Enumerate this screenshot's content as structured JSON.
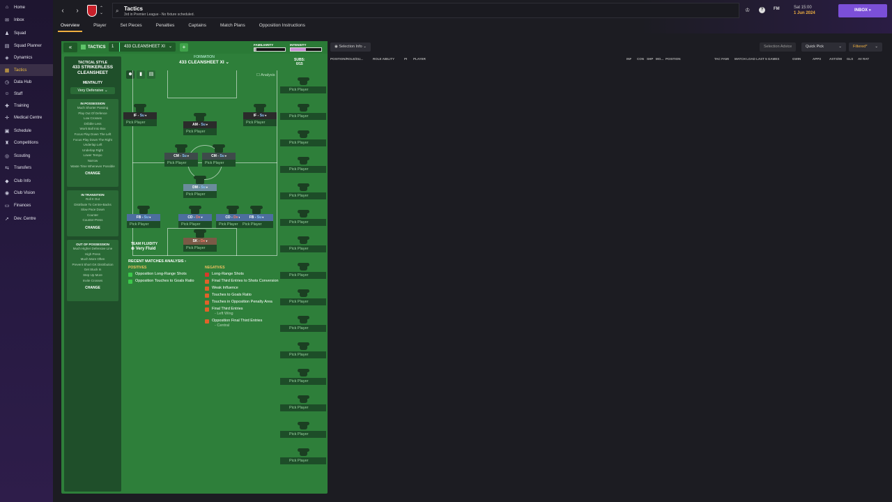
{
  "sidebar": {
    "items": [
      {
        "label": "Home",
        "icon": "home-icon",
        "glyph": "⌂"
      },
      {
        "label": "Inbox",
        "icon": "inbox-icon",
        "glyph": "✉"
      },
      {
        "label": "Squad",
        "icon": "squad-icon",
        "glyph": "♟"
      },
      {
        "label": "Squad Planner",
        "icon": "planner-icon",
        "glyph": "▤"
      },
      {
        "label": "Dynamics",
        "icon": "dynamics-icon",
        "glyph": "◈"
      },
      {
        "label": "Tactics",
        "icon": "tactics-icon",
        "glyph": "▦"
      },
      {
        "label": "Data Hub",
        "icon": "data-hub-icon",
        "glyph": "◷"
      },
      {
        "label": "Staff",
        "icon": "staff-icon",
        "glyph": "☺"
      },
      {
        "label": "Training",
        "icon": "training-icon",
        "glyph": "✚"
      },
      {
        "label": "Medical Centre",
        "icon": "medical-icon",
        "glyph": "✛"
      },
      {
        "label": "Schedule",
        "icon": "schedule-icon",
        "glyph": "▣"
      },
      {
        "label": "Competitions",
        "icon": "competitions-icon",
        "glyph": "♜"
      },
      {
        "label": "Scouting",
        "icon": "scouting-icon",
        "glyph": "◎"
      },
      {
        "label": "Transfers",
        "icon": "transfers-icon",
        "glyph": "⇆"
      },
      {
        "label": "Club Info",
        "icon": "club-info-icon",
        "glyph": "◆"
      },
      {
        "label": "Club Vision",
        "icon": "club-vision-icon",
        "glyph": "◉"
      },
      {
        "label": "Finances",
        "icon": "finances-icon",
        "glyph": "▭"
      },
      {
        "label": "Dev. Centre",
        "icon": "dev-centre-icon",
        "glyph": "➚"
      }
    ],
    "active": "Tactics"
  },
  "header": {
    "title": "Tactics",
    "subtitle": "3rd in Premier League - No fixture scheduled.",
    "time": "Sat 15:00",
    "date": "1 Jun 2024",
    "fm_label": "FM",
    "inbox_label": "INBOX"
  },
  "tabs": [
    "Overview",
    "Player",
    "Set Pieces",
    "Penalties",
    "Captains",
    "Match Plans",
    "Opposition Instructions"
  ],
  "tactics_bar": {
    "label": "TACTICS",
    "number": "1",
    "name": "433 CLEANSHEET XI",
    "familiarity_label": "FAMILIARITY",
    "intensity_label": "INTENSITY",
    "familiarity": 0.0,
    "intensity": 0.5
  },
  "left_col": {
    "style_label": "TACTICAL STYLE",
    "style_name": "433 STRIKERLESS CLEANSHEET",
    "mentality_label": "MENTALITY",
    "mentality": "Very Defensive",
    "in_possession": {
      "title": "IN POSSESSION",
      "lines": [
        "Much Shorter Passing",
        "Play Out Of Defence",
        "Low Crosses",
        "Dribble Less",
        "Work Ball Into Box",
        "Focus Play Down The Left",
        "Focus Play Down The Right",
        "Underlap Left",
        "Underlap Right",
        "Lower Tempo",
        "Narrow",
        "Waste Time Whenever Possible"
      ],
      "change": "CHANGE"
    },
    "in_transition": {
      "title": "IN TRANSITION",
      "lines": [
        "Roll It Out",
        "Distribute To Centre-Backs",
        "Slow Pace Down",
        "Counter",
        "Counter-Press"
      ],
      "change": "CHANGE"
    },
    "out_of_possession": {
      "title": "OUT OF POSSESSION",
      "lines": [
        "Much Higher Defensive Line",
        "High Press",
        "Much More Often",
        "Prevent Short GK Distribution",
        "Get Stuck In",
        "Step Up More",
        "Invite Crosses"
      ],
      "change": "CHANGE"
    }
  },
  "formation": {
    "label": "FORMATION",
    "name": "433 CLEANSHEET XI",
    "subs_label": "SUBS:",
    "subs_count": "0/15",
    "analysis_label": "Analysis",
    "fluidity_label": "TEAM FLUIDITY",
    "fluidity": "Very Fluid",
    "pick_player": "Pick Player",
    "positions": [
      {
        "role": "IF",
        "duty": "Su",
        "kind": "att"
      },
      {
        "role": "AM",
        "duty": "Su",
        "kind": "att"
      },
      {
        "role": "IF",
        "duty": "Su",
        "kind": "att"
      },
      {
        "role": "CM",
        "duty": "Su",
        "kind": "mid"
      },
      {
        "role": "CM",
        "duty": "Su",
        "kind": "mid"
      },
      {
        "role": "DM",
        "duty": "Su",
        "kind": "dm"
      },
      {
        "role": "FB",
        "duty": "Su",
        "kind": "def"
      },
      {
        "role": "CD",
        "duty": "De",
        "kind": "def"
      },
      {
        "role": "CD",
        "duty": "De",
        "kind": "def"
      },
      {
        "role": "FB",
        "duty": "Su",
        "kind": "def"
      },
      {
        "role": "SK",
        "duty": "De",
        "kind": "gk"
      }
    ],
    "subs": [
      "Pick Player",
      "Pick Player",
      "Pick Player",
      "Pick Player",
      "Pick Player",
      "Pick Player",
      "Pick Player",
      "Pick Player",
      "Pick Player",
      "Pick Player",
      "Pick Player",
      "Pick Player",
      "Pick Player",
      "Pick Player",
      "Pick Player"
    ]
  },
  "analysis": {
    "title": "RECENT MATCHES ANALYSIS",
    "positives_label": "POSITIVES",
    "positives": [
      "Opposition Long-Range Shots",
      "Opposition Touches to Goals Ratio"
    ],
    "negatives_label": "NEGATIVES",
    "negatives": [
      {
        "text": "Long-Range Shots",
        "sub": ""
      },
      {
        "text": "Final Third Entries to Shots Conversion",
        "sub": ""
      },
      {
        "text": "Weak Influence",
        "sub": ""
      },
      {
        "text": "Touches to Goals Ratio",
        "sub": ""
      },
      {
        "text": "Touches in Opposition Penalty Area",
        "sub": ""
      },
      {
        "text": "Final Third Entries",
        "sub": "- Left Wing"
      },
      {
        "text": "Opposition Final Third Entries",
        "sub": "- Central"
      }
    ]
  },
  "right": {
    "selection_info": "Selection Info",
    "selection_advice": "Selection Advice",
    "quick_pick": "Quick Pick",
    "filtered": "Filtered*",
    "columns": [
      "POSITION/ROLE/DU...",
      "ROLE ABILITY",
      "PI",
      "PLAYER",
      "INF",
      "CON",
      "SHP",
      "MO...",
      "POSITION",
      "TAC FAMI",
      "MATCH LOAD LAST 5 GAMES",
      "GWIN",
      "APPS",
      "ASTS/90",
      "GLS",
      "AV RAT"
    ]
  },
  "colors": {
    "accent": "#f0b040",
    "pitch": "#2e7f3a",
    "inbox": "#7b4fd8"
  }
}
